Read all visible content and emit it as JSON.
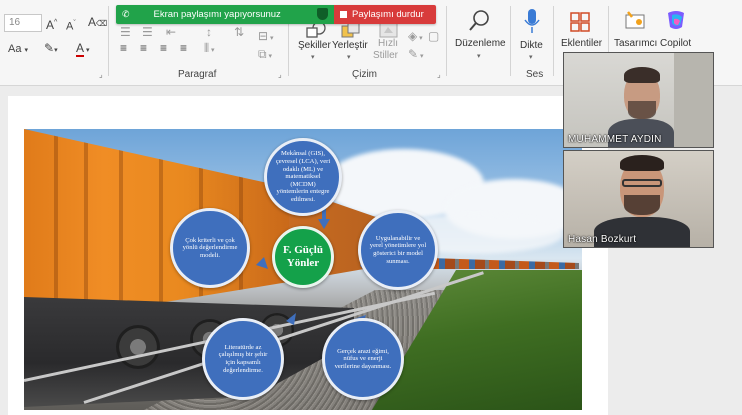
{
  "ribbon": {
    "font_size": "16",
    "groups": {
      "paragraph": "Paragraf",
      "drawing": "Çizim",
      "voice": "Ses"
    },
    "buttons": {
      "shapes": "Şekiller",
      "arrange": "Yerleştir",
      "quick_styles_1": "Hızlı",
      "quick_styles_2": "Stiller",
      "editing": "Düzenleme",
      "dictate": "Dikte",
      "addins": "Eklentiler",
      "designer": "Tasarımcı",
      "copilot": "Copilot"
    }
  },
  "share_bar": {
    "status": "Ekran paylaşımı yapıyorsunuz",
    "stop": "Paylaşımı durdur"
  },
  "slide": {
    "center": "F. Güçlü Yönler",
    "nodes": {
      "top": "Mekânsal (GIS), çevresel (LCA), veri odaklı (ML) ve matematiksel (MCDM) yöntemlerin entegre edilmesi.",
      "right": "Uygulanabilir ve yerel yönetimlere yol gösterici bir model sunması.",
      "bottom_right": "Gerçek arazi eğimi, nüfus ve enerji verilerine dayanması.",
      "bottom_left": "Literatürde az çalışılmış bir şehir için kapsamlı değerlendirme.",
      "left": "Çok kriterli ve çok yönlü değerlendirme modeli."
    }
  },
  "participants": [
    {
      "name": "MUHAMMET AYDIN"
    },
    {
      "name": "Hasan Bozkurt"
    }
  ],
  "colors": {
    "share_green": "#21a34a",
    "share_red": "#d83b3b",
    "node_blue": "#3f6fbd",
    "center_green": "#14a14a",
    "copilot": "#7b5cff"
  }
}
